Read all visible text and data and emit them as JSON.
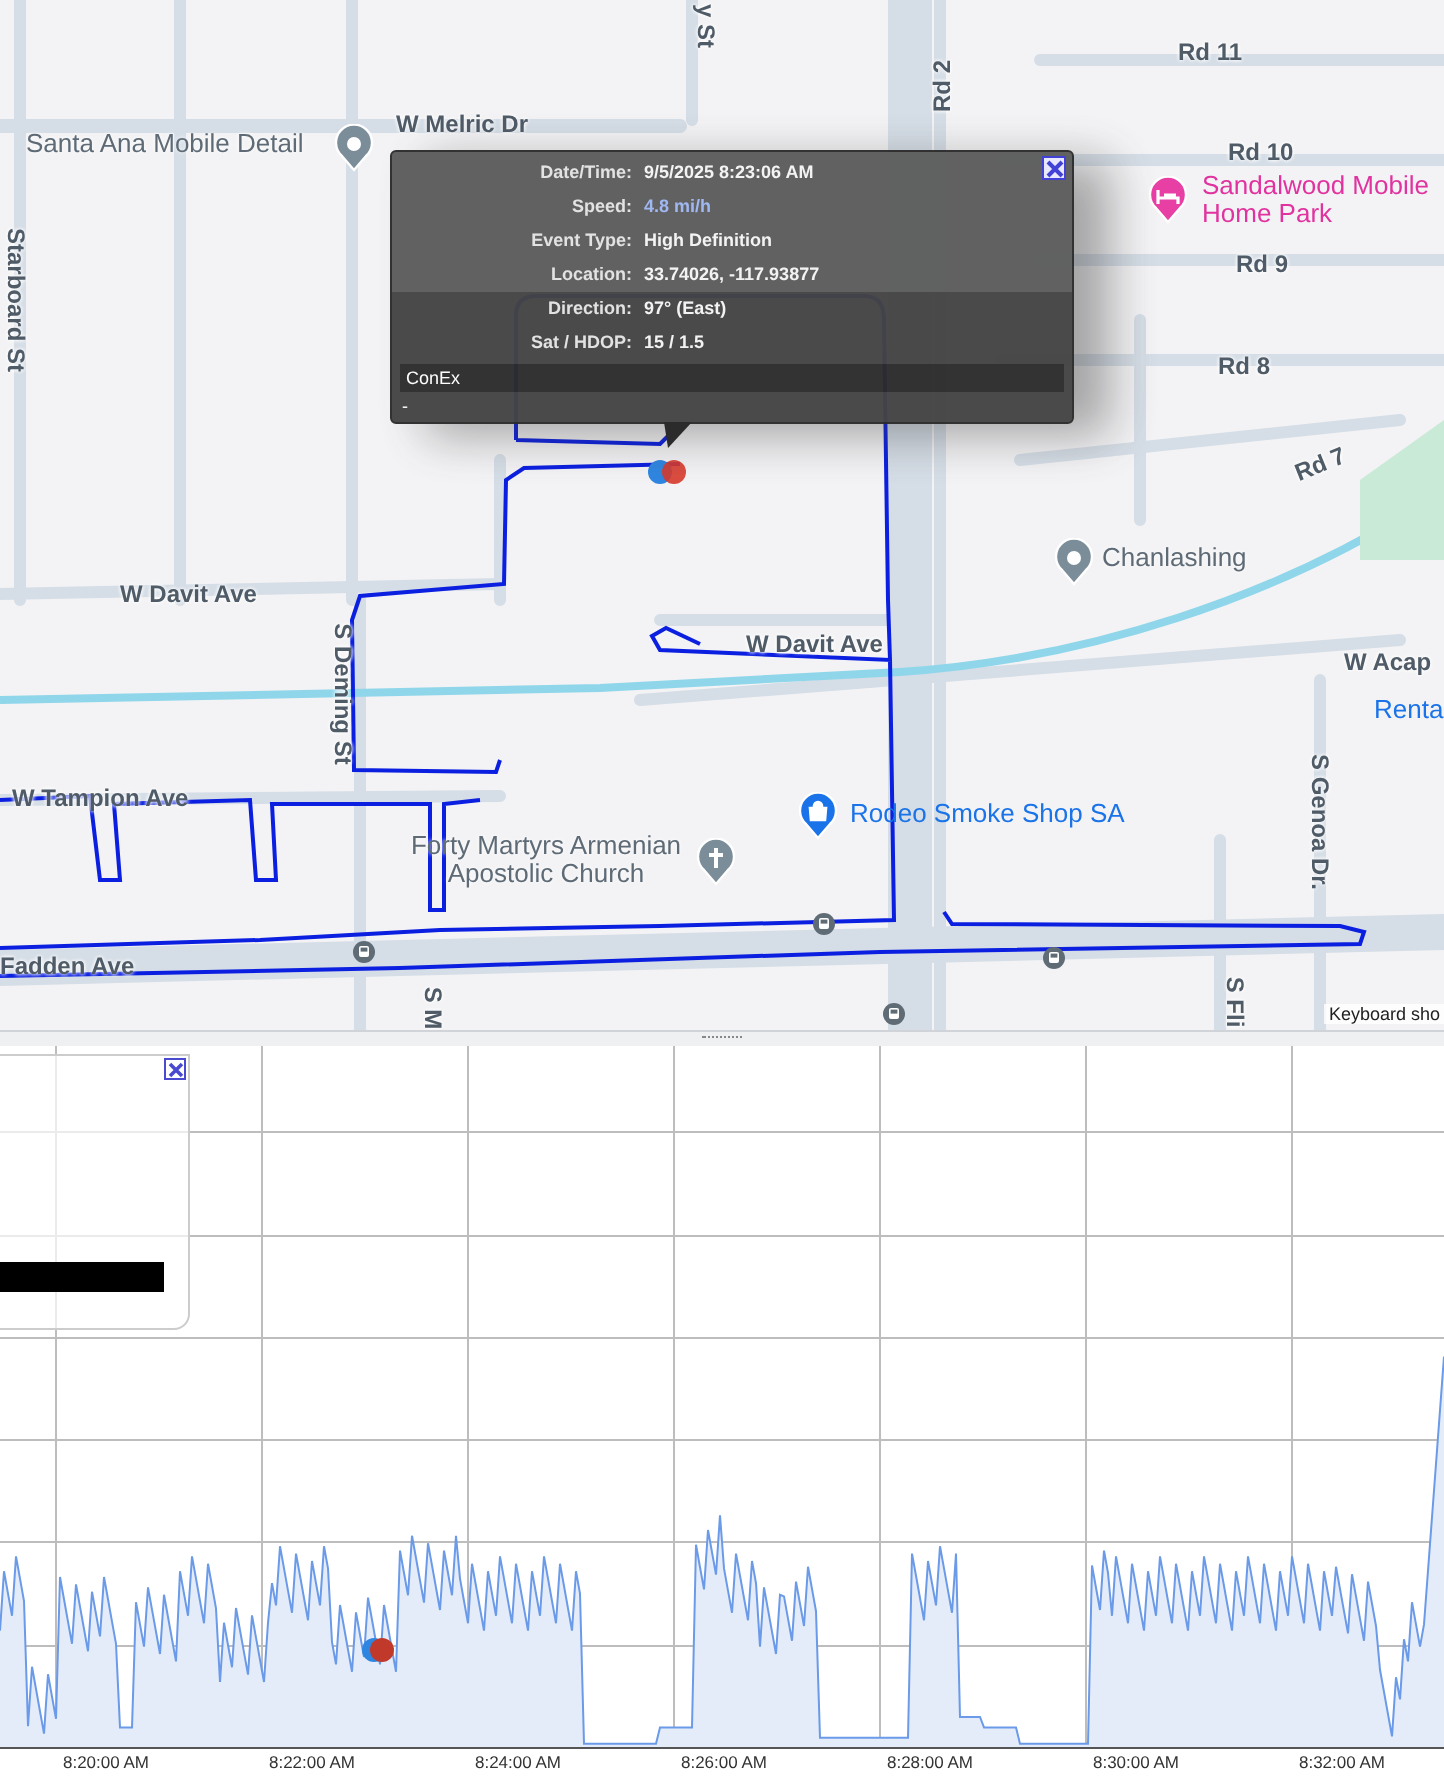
{
  "map": {
    "labels": [
      {
        "text": "y St",
        "kind": "street"
      },
      {
        "text": "Rd 11",
        "kind": "street"
      },
      {
        "text": "Rd 2",
        "kind": "street"
      },
      {
        "text": "W Melric Dr",
        "kind": "street"
      },
      {
        "text": "Santa Ana Mobile Detail",
        "kind": "place"
      },
      {
        "text": "Rd 10",
        "kind": "street"
      },
      {
        "text": "Sandalwood Mobile Home Park",
        "kind": "lodging"
      },
      {
        "text": "Starboard St",
        "kind": "street"
      },
      {
        "text": "Rd 9",
        "kind": "street"
      },
      {
        "text": "Rd 8",
        "kind": "street"
      },
      {
        "text": "Rd 7",
        "kind": "street"
      },
      {
        "text": "Chanlashing",
        "kind": "place"
      },
      {
        "text": "W Davit Ave",
        "kind": "street"
      },
      {
        "text": "S Deming St",
        "kind": "street"
      },
      {
        "text": "W Davit Ave",
        "kind": "street"
      },
      {
        "text": "W Acap",
        "kind": "street"
      },
      {
        "text": "Renta",
        "kind": "link"
      },
      {
        "text": "S Genoa Dr.",
        "kind": "street"
      },
      {
        "text": "W Tampion Ave",
        "kind": "street"
      },
      {
        "text": "Rodeo Smoke Shop SA",
        "kind": "shop"
      },
      {
        "text": "Forty Martyrs Armenian Apostolic Church",
        "kind": "church"
      },
      {
        "text": "Fadden Ave",
        "kind": "street"
      },
      {
        "text": "S Fli",
        "kind": "street"
      },
      {
        "text": "S M",
        "kind": "street"
      }
    ],
    "attribution": "Keyboard sho",
    "info_popup": {
      "rows": [
        {
          "label": "Date/Time:",
          "value": "9/5/2025 8:23:06 AM",
          "highlight": false
        },
        {
          "label": "Speed:",
          "value": "4.8 mi/h",
          "highlight": true
        },
        {
          "label": "Event Type:",
          "value": "High Definition",
          "highlight": false
        },
        {
          "label": "Location:",
          "value": "33.74026, -117.93877",
          "highlight": false
        },
        {
          "label": "Direction:",
          "value": "97° (East)",
          "highlight": false
        },
        {
          "label": "Sat / HDOP:",
          "value": "15 / 1.5",
          "highlight": false
        }
      ],
      "section_title": "ConEx",
      "section_value": "-"
    }
  },
  "chart": {
    "x_labels": [
      "8:20:00 AM",
      "8:22:00 AM",
      "8:24:00 AM",
      "8:26:00 AM",
      "8:28:00 AM",
      "8:30:00 AM",
      "8:32:00 AM"
    ]
  }
}
